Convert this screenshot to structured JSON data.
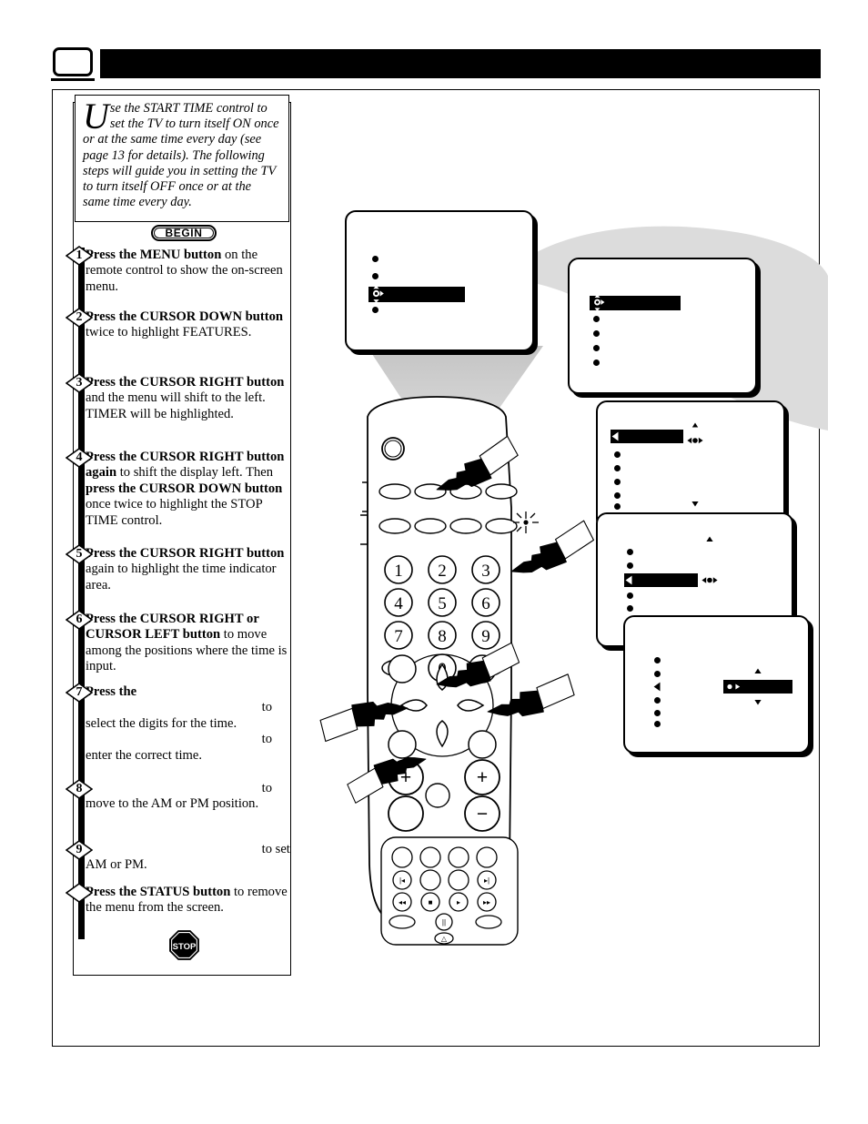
{
  "page": {
    "number": "",
    "header_title": ""
  },
  "intro": {
    "dropcap": "U",
    "text": "se the START TIME control to set the TV to turn itself ON once or at the same time every day (see page 13  for details).  The following steps will guide you in setting the TV to turn itself OFF once or at the same time every day."
  },
  "badges": {
    "begin": "BEGIN",
    "stop": "STOP"
  },
  "steps": [
    {
      "number": "1",
      "segments": [
        {
          "type": "bold",
          "text": "Press the MENU button"
        },
        {
          "type": "plain",
          "text": " on the remote control to show the on-screen menu."
        }
      ]
    },
    {
      "number": "2",
      "segments": [
        {
          "type": "bold",
          "text": "Press the CURSOR DOWN button"
        },
        {
          "type": "plain",
          "text": " twice to highlight FEATURES."
        }
      ]
    },
    {
      "number": "3",
      "segments": [
        {
          "type": "bold",
          "text": "Press the CURSOR RIGHT button"
        },
        {
          "type": "plain",
          "text": " and the menu will shift to the left. TIMER will be highlighted."
        }
      ]
    },
    {
      "number": "4",
      "segments": [
        {
          "type": "bold",
          "text": "Press the CURSOR RIGHT button again"
        },
        {
          "type": "plain",
          "text": " to shift the display left. Then "
        },
        {
          "type": "bold",
          "text": "press the CURSOR DOWN button"
        },
        {
          "type": "plain",
          "text": " once twice to highlight the STOP TIME control."
        }
      ]
    },
    {
      "number": "5",
      "segments": [
        {
          "type": "bold",
          "text": "Press the CURSOR RIGHT button"
        },
        {
          "type": "plain",
          "text": " again to highlight the time indicator area."
        }
      ]
    },
    {
      "number": "6",
      "segments": [
        {
          "type": "bold",
          "text": "Press the CURSOR RIGHT or CURSOR LEFT button"
        },
        {
          "type": "plain",
          "text": " to move among the positions where the time is input."
        }
      ]
    },
    {
      "number": "7",
      "segments": [
        {
          "type": "bold",
          "text": "Press the "
        },
        {
          "type": "gap",
          "text": ""
        },
        {
          "type": "plain",
          "text": " to select the digits for the time. "
        },
        {
          "type": "gap",
          "text": ""
        },
        {
          "type": "plain",
          "text": " to enter the correct time."
        }
      ]
    },
    {
      "number": "8",
      "segments": [
        {
          "type": "gap",
          "text": ""
        },
        {
          "type": "plain",
          "text": " to move to the AM or PM position."
        }
      ]
    },
    {
      "number": "9",
      "segments": [
        {
          "type": "gap",
          "text": ""
        },
        {
          "type": "plain",
          "text": " to set AM or PM."
        }
      ]
    },
    {
      "number": "",
      "segments": [
        {
          "type": "bold",
          "text": "Press the STATUS button"
        },
        {
          "type": "plain",
          "text": " to remove the menu from the screen."
        }
      ]
    }
  ],
  "tv_screens": [
    {
      "id": "screen-1",
      "caption": "",
      "items_above": 2,
      "highlight_index": 2,
      "items_below": 1,
      "cursor": "up-down-right"
    },
    {
      "id": "screen-2",
      "caption": "",
      "items_above": 0,
      "highlight_index": 0,
      "items_below": 4,
      "cursor": "up-down-right"
    },
    {
      "id": "screen-3",
      "caption": "",
      "items_above": 0,
      "highlight_index": 0,
      "items_below": 5,
      "cursor": "left-right-updown"
    },
    {
      "id": "screen-4",
      "caption": "",
      "items_above": 2,
      "highlight_index": 2,
      "items_below": 3,
      "cursor": "left-right-updown"
    },
    {
      "id": "screen-5",
      "caption": "",
      "items_above": 6,
      "highlight_index": 2,
      "items_below": 0,
      "cursor": "time-field-updown"
    }
  ],
  "remote": {
    "keypad": [
      "1",
      "2",
      "3",
      "4",
      "5",
      "6",
      "7",
      "8",
      "9",
      "0"
    ],
    "volume_plus": "+",
    "channel_plus": "+",
    "minus": "−",
    "vcr_buttons": [
      "|◂",
      "▸|",
      "◂◂",
      "■",
      "▸",
      "▸▸",
      "||",
      "△"
    ],
    "light_icon": "light-icon"
  },
  "colors": {
    "ink": "#000000",
    "paper": "#ffffff",
    "swoosh_gray": "#dcdcdc",
    "beam_gray": "#c9c9c9"
  }
}
